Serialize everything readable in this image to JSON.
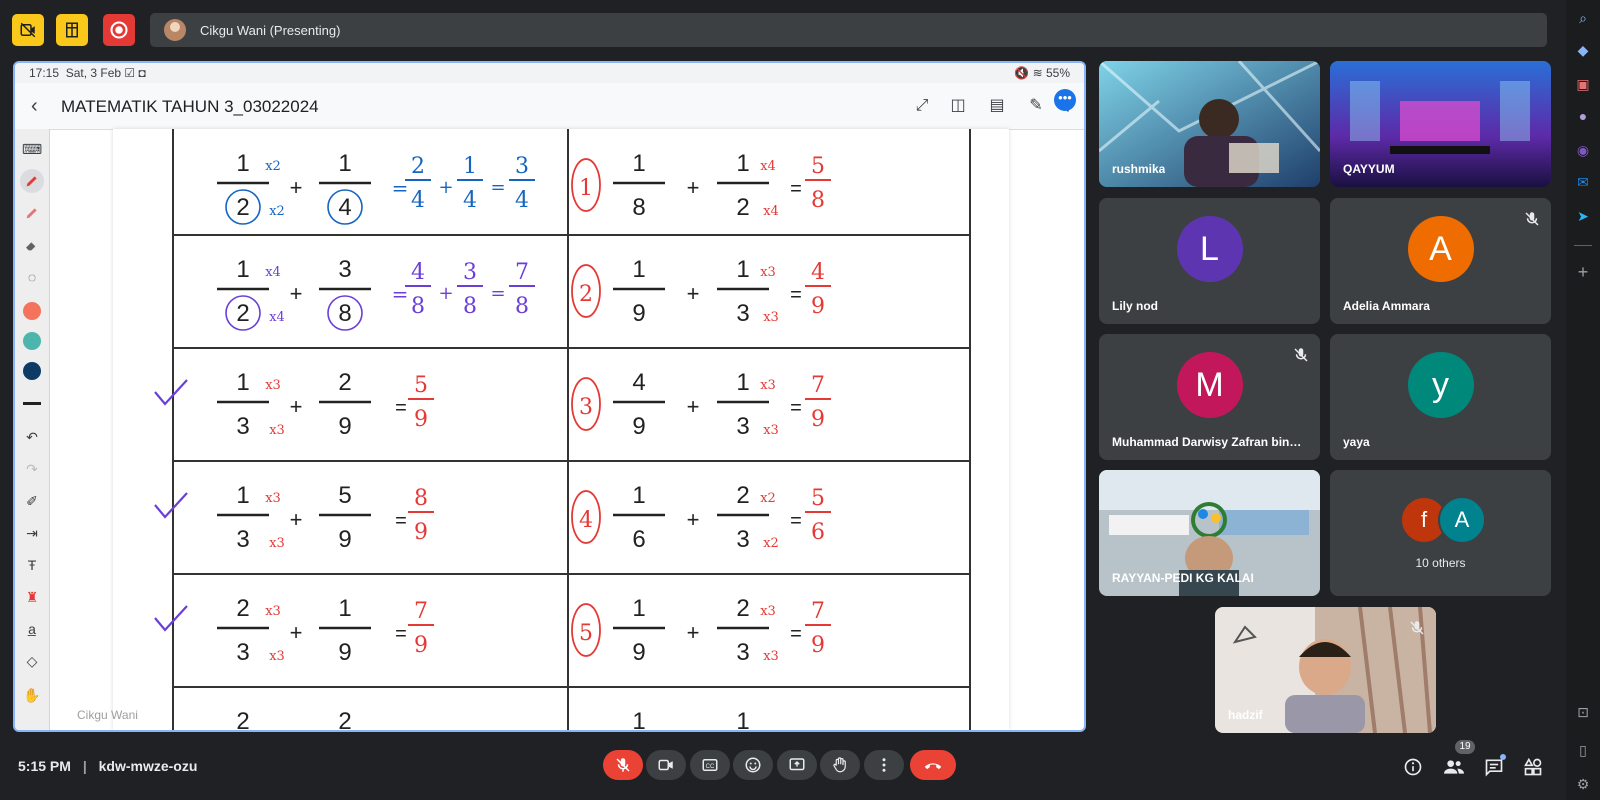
{
  "top_bar": {
    "presenter_label": "Cikgu Wani (Presenting)"
  },
  "screen": {
    "status_time": "17:15",
    "status_date": "Sat, 3 Feb",
    "battery": "55%",
    "doc_title": "MATEMATIK TAHUN 3_03022024",
    "presenter_watermark": "Cikgu Wani",
    "worksheet": {
      "rows": [
        {
          "left": {
            "n1": "1",
            "d1": "2",
            "n2": "1",
            "d2": "4",
            "mul_n": "x2",
            "mul_d": "x2",
            "work": [
              "2/4",
              "+",
              "1/4",
              "=",
              "3/4"
            ],
            "work_color": "#1565c0",
            "check": false
          },
          "right": {
            "num": "1",
            "n1": "1",
            "d1": "8",
            "n2": "1",
            "d2": "2",
            "mul_n": "x4",
            "mul_d": "x4",
            "answer": "5/8"
          }
        },
        {
          "left": {
            "n1": "1",
            "d1": "2",
            "n2": "3",
            "d2": "8",
            "mul_n": "x4",
            "mul_d": "x4",
            "work": [
              "4/8",
              "+",
              "3/8",
              "=",
              "7/8"
            ],
            "work_color": "#6a3fd8",
            "check": false
          },
          "right": {
            "num": "2",
            "n1": "1",
            "d1": "9",
            "n2": "1",
            "d2": "3",
            "mul_n": "x3",
            "mul_d": "x3",
            "answer": "4/9"
          }
        },
        {
          "left": {
            "n1": "1",
            "d1": "3",
            "n2": "2",
            "d2": "9",
            "mul_n": "x3",
            "mul_d": "x3",
            "answer": "5/9",
            "check": true
          },
          "right": {
            "num": "3",
            "n1": "4",
            "d1": "9",
            "n2": "1",
            "d2": "3",
            "mul_n": "x3",
            "mul_d": "x3",
            "answer": "7/9"
          }
        },
        {
          "left": {
            "n1": "1",
            "d1": "3",
            "n2": "5",
            "d2": "9",
            "mul_n": "x3",
            "mul_d": "x3",
            "answer": "8/9",
            "check": true
          },
          "right": {
            "num": "4",
            "n1": "1",
            "d1": "6",
            "n2": "2",
            "d2": "3",
            "mul_n": "x2",
            "mul_d": "x2",
            "answer": "5/6"
          }
        },
        {
          "left": {
            "n1": "2",
            "d1": "3",
            "n2": "1",
            "d2": "9",
            "mul_n": "x3",
            "mul_d": "x3",
            "answer": "7/9",
            "check": true
          },
          "right": {
            "num": "5",
            "n1": "1",
            "d1": "9",
            "n2": "2",
            "d2": "3",
            "mul_n": "x3",
            "mul_d": "x3",
            "answer": "7/9"
          }
        }
      ],
      "partial_row": {
        "left_n1": "2",
        "left_n2": "2",
        "right_n1": "1",
        "right_n2": "1"
      }
    }
  },
  "participants": [
    {
      "name": "rushmika",
      "kind": "video",
      "muted": false
    },
    {
      "name": "QAYYUM",
      "kind": "video",
      "muted": false
    },
    {
      "name": "Lily nod",
      "kind": "avatar",
      "initial": "L",
      "color": "#5e35b1",
      "muted": false
    },
    {
      "name": "Adelia Ammara",
      "kind": "avatar",
      "initial": "A",
      "color": "#ef6c00",
      "muted": true
    },
    {
      "name": "Muhammad Darwisy Zafran bin ...",
      "kind": "avatar",
      "initial": "M",
      "color": "#c2185b",
      "muted": true
    },
    {
      "name": "yaya",
      "kind": "avatar",
      "initial": "y",
      "color": "#00897b",
      "muted": false
    },
    {
      "name": "RAYYAN-PEDI KG KALAI",
      "kind": "video",
      "muted": false
    },
    {
      "name": "10 others",
      "kind": "others",
      "initials": [
        "f",
        "A"
      ],
      "colors": [
        "#bf360c",
        "#00838f"
      ]
    },
    {
      "name": "hadzif",
      "kind": "video",
      "muted": true
    }
  ],
  "bottom_bar": {
    "time": "5:15 PM",
    "meeting_code": "kdw-mwze-ozu",
    "people_count": "19"
  },
  "icons": {
    "mic": "mic-off-icon",
    "camera": "camera-icon",
    "captions": "captions-icon",
    "emoji": "emoji-icon",
    "present": "present-icon",
    "hand": "raise-hand-icon",
    "more": "more-vert-icon",
    "end": "end-call-icon",
    "info": "info-icon",
    "people": "people-icon",
    "chat": "chat-icon",
    "activities": "activities-icon"
  },
  "colors": {
    "accent": "#8ab4f8",
    "danger": "#ea4335",
    "highlight_yellow": "#f9c81a",
    "ink_red": "#e53935",
    "ink_purple": "#6a3fd8"
  }
}
